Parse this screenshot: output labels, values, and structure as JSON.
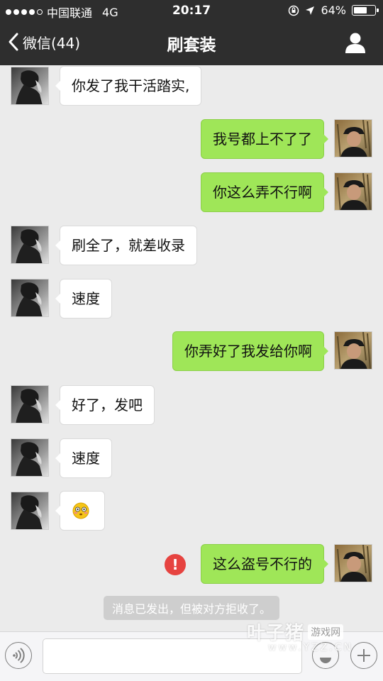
{
  "status_bar": {
    "carrier": "中国联通",
    "network": "4G",
    "time": "20:17",
    "battery": "64%",
    "battery_level": 0.64
  },
  "nav": {
    "back_label": "微信(44)",
    "title": "刷套装"
  },
  "messages": [
    {
      "from": "peer",
      "text": "你发了我干活踏实,"
    },
    {
      "from": "self",
      "text": "我号都上不了了"
    },
    {
      "from": "self",
      "text": "你这么弄不行啊"
    },
    {
      "from": "peer",
      "text": "刷全了，就差收录"
    },
    {
      "from": "peer",
      "text": "速度"
    },
    {
      "from": "self",
      "text": "你弄好了我发给你啊"
    },
    {
      "from": "peer",
      "text": "好了，发吧"
    },
    {
      "from": "peer",
      "text": "速度"
    },
    {
      "from": "peer",
      "text": "",
      "emoji": "flushed-face"
    },
    {
      "from": "self",
      "text": "这么盗号不行的",
      "status": "error"
    }
  ],
  "system_note": "消息已发出，但被对方拒收了。",
  "input": {
    "value": "",
    "placeholder": ""
  },
  "watermark": {
    "brand": "叶子猪",
    "tag": "游戏网",
    "url": "www.YZZ.CN"
  },
  "colors": {
    "header_bg": "#2e2e2e",
    "chat_bg": "#ebebeb",
    "self_bubble": "#9fe658",
    "peer_bubble": "#ffffff",
    "error": "#e64340"
  }
}
